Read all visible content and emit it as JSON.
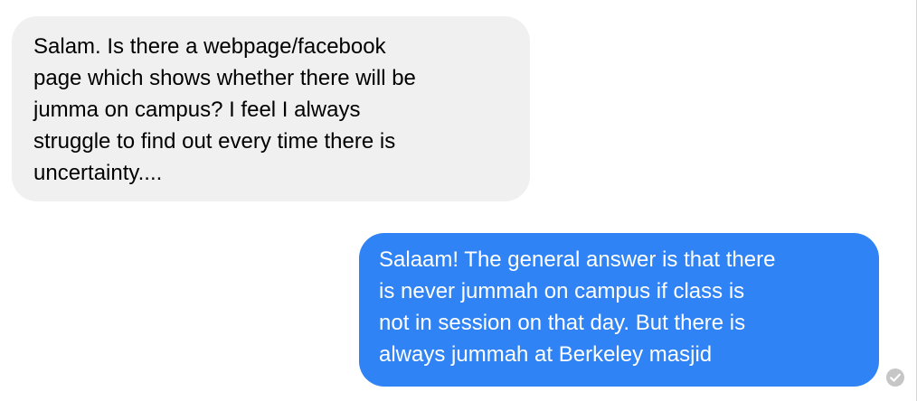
{
  "conversation": {
    "messages": [
      {
        "direction": "incoming",
        "text": "Salam. Is there a webpage/facebook\npage which shows whether there will be\njumma on campus? I feel I always\nstruggle to find out every time there is\nuncertainty...."
      },
      {
        "direction": "outgoing",
        "text": "Salaam! The general answer is that there\nis never jummah on campus if class is\nnot in session on that day. But there is\nalways jummah at Berkeley masjid"
      }
    ],
    "status_icon": "check-circle-icon"
  },
  "colors": {
    "incoming_bubble": "#f0f0f0",
    "outgoing_bubble": "#2f83f4",
    "outgoing_text": "#ffffff",
    "status_icon": "#c6c6c6"
  }
}
